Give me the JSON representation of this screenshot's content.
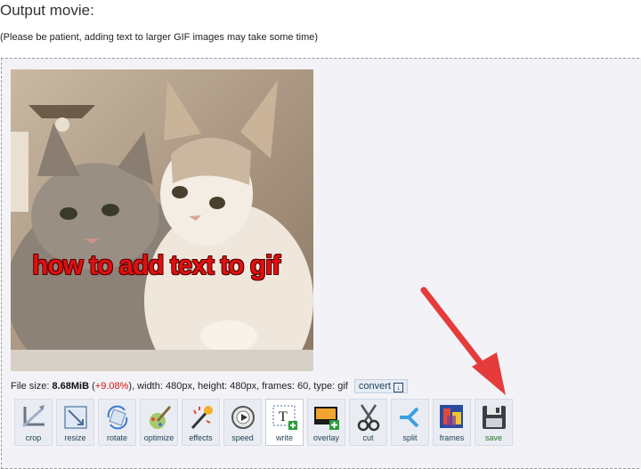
{
  "page": {
    "title": "Output movie:",
    "note": "(Please be patient, adding text to larger GIF images may take some time)"
  },
  "gif": {
    "caption": "how to add text to gif"
  },
  "fileinfo": {
    "size_label": "File size: ",
    "size_value": "8.68MiB",
    "pct_open": " (",
    "pct_value": "+9.08%",
    "rest": "), width: 480px, height: 480px, frames: 60, type: gif",
    "convert": "convert"
  },
  "toolbar": {
    "tools": [
      {
        "label": "crop",
        "icon": "crop-icon"
      },
      {
        "label": "resize",
        "icon": "resize-icon"
      },
      {
        "label": "rotate",
        "icon": "rotate-icon"
      },
      {
        "label": "optimize",
        "icon": "optimize-icon"
      },
      {
        "label": "effects",
        "icon": "effects-icon"
      },
      {
        "label": "speed",
        "icon": "speed-icon"
      },
      {
        "label": "write",
        "icon": "write-icon"
      },
      {
        "label": "overlay",
        "icon": "overlay-icon"
      },
      {
        "label": "cut",
        "icon": "cut-icon"
      },
      {
        "label": "split",
        "icon": "split-icon"
      },
      {
        "label": "frames",
        "icon": "frames-icon"
      },
      {
        "label": "save",
        "icon": "save-icon"
      }
    ]
  },
  "colors": {
    "caption": "#e01010",
    "percent": "#dd1111",
    "save_label": "#1a7d1a",
    "arrow": "#e53b3b"
  }
}
